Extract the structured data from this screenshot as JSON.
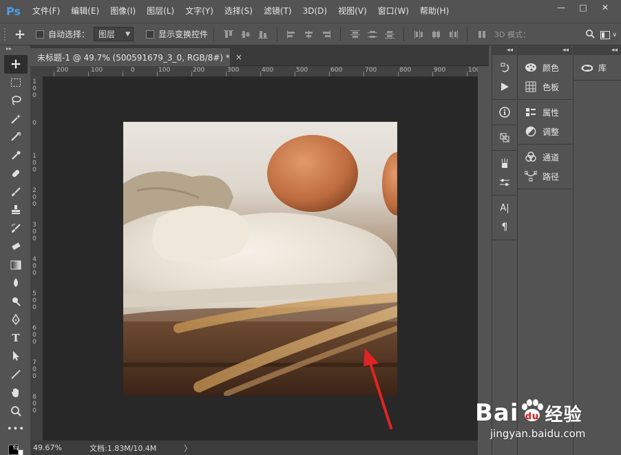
{
  "app": {
    "logo": "Ps",
    "menu": [
      "文件(F)",
      "编辑(E)",
      "图像(I)",
      "图层(L)",
      "文字(Y)",
      "选择(S)",
      "滤镜(T)",
      "3D(D)",
      "视图(V)",
      "窗口(W)",
      "帮助(H)"
    ],
    "window_buttons": [
      "—",
      "□",
      "✕"
    ]
  },
  "options": {
    "auto_select_label": "自动选择：",
    "auto_select_value": "图层",
    "show_transform_label": "显示变换控件",
    "mode_3d_label": "3D 模式："
  },
  "document": {
    "tab_title": "未标题-1 @ 49.7% (500591679_3_0, RGB/8#) *",
    "tab_close": "×",
    "ruler_top": [
      "200",
      "100",
      "0",
      "100",
      "200",
      "300",
      "400",
      "500",
      "600",
      "700",
      "800",
      "900",
      "100"
    ],
    "ruler_left": [
      "1\n0\n0",
      "0",
      "1\n0\n0",
      "2\n0\n0",
      "3\n0\n0",
      "4\n0\n0",
      "5\n0\n0",
      "6\n0\n0",
      "7\n0\n0",
      "8\n0\n0"
    ],
    "zoom": "49.67%",
    "doc_info": "文档:1.83M/10.4M",
    "status_arrow": "〉"
  },
  "panels": {
    "group1": [
      {
        "icon": "palette-icon",
        "label": "颜色"
      },
      {
        "icon": "swatches-icon",
        "label": "色板"
      }
    ],
    "group2": [
      {
        "icon": "properties-icon",
        "label": "属性"
      },
      {
        "icon": "adjustments-icon",
        "label": "调整"
      }
    ],
    "group3": [
      {
        "icon": "channels-icon",
        "label": "通道"
      },
      {
        "icon": "paths-icon",
        "label": "路径"
      }
    ],
    "library_label": "库",
    "collapse_glyph": "◂◂",
    "expand_glyph": "▸▸"
  },
  "watermark": {
    "brand_a": "Bai",
    "brand_b": "经验",
    "url": "jingyan.baidu.com"
  },
  "colors": {
    "ui_bg": "#535353",
    "canvas_bg": "#282828",
    "accent": "#4aa0e6",
    "annotation_red": "#e02424"
  }
}
